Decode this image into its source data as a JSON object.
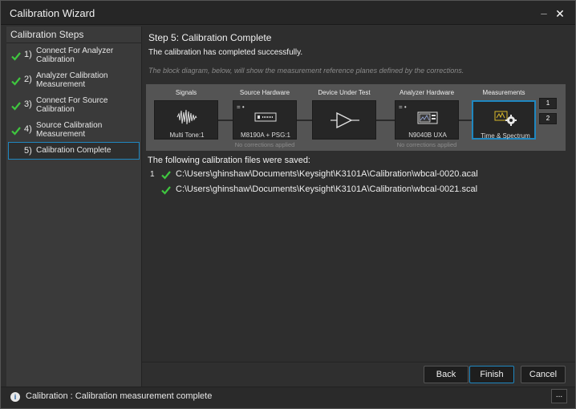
{
  "window": {
    "title": "Calibration Wizard",
    "minimize_glyph": "_",
    "close_glyph": "✕"
  },
  "sidebar": {
    "title": "Calibration Steps",
    "steps": [
      {
        "num": "1)",
        "label": "Connect For Analyzer Calibration",
        "done": true
      },
      {
        "num": "2)",
        "label": "Analyzer Calibration Measurement",
        "done": true
      },
      {
        "num": "3)",
        "label": "Connect For Source Calibration",
        "done": true
      },
      {
        "num": "4)",
        "label": "Source Calibration Measurement",
        "done": true
      },
      {
        "num": "5)",
        "label": "Calibration Complete",
        "done": false,
        "active": true
      }
    ]
  },
  "main": {
    "step_title": "Step 5: Calibration Complete",
    "success": "The calibration has completed successfully.",
    "hint": "The block diagram, below, will show the measurement reference planes defined by the corrections.",
    "diagram": {
      "signals": {
        "header": "Signals",
        "caption": "Multi Tone:1"
      },
      "source": {
        "header": "Source Hardware",
        "caption": "M8190A + PSG:1",
        "eq": "= •",
        "note": "No corrections applied"
      },
      "dut": {
        "header": "Device Under Test"
      },
      "analyzer": {
        "header": "Analyzer Hardware",
        "caption": "N9040B UXA",
        "eq": "= •",
        "note": "No corrections applied"
      },
      "measurements": {
        "header": "Measurements",
        "caption": "Time & Spectrum",
        "buttons": [
          "1",
          "2"
        ]
      }
    },
    "files_title": "The following calibration files were saved:",
    "files": [
      {
        "index": "1",
        "path": "C:\\Users\\ghinshaw\\Documents\\Keysight\\K3101A\\Calibration\\wbcal-0020.acal"
      },
      {
        "index": "",
        "path": "C:\\Users\\ghinshaw\\Documents\\Keysight\\K3101A\\Calibration\\wbcal-0021.scal"
      }
    ]
  },
  "buttons": {
    "back": "Back",
    "finish": "Finish",
    "cancel": "Cancel"
  },
  "status": {
    "icon": "info-icon",
    "info_glyph": "i",
    "text": "Calibration : Calibration measurement complete",
    "more": "..."
  },
  "colors": {
    "check": "#3fc63f",
    "accent": "#1f87c0"
  }
}
